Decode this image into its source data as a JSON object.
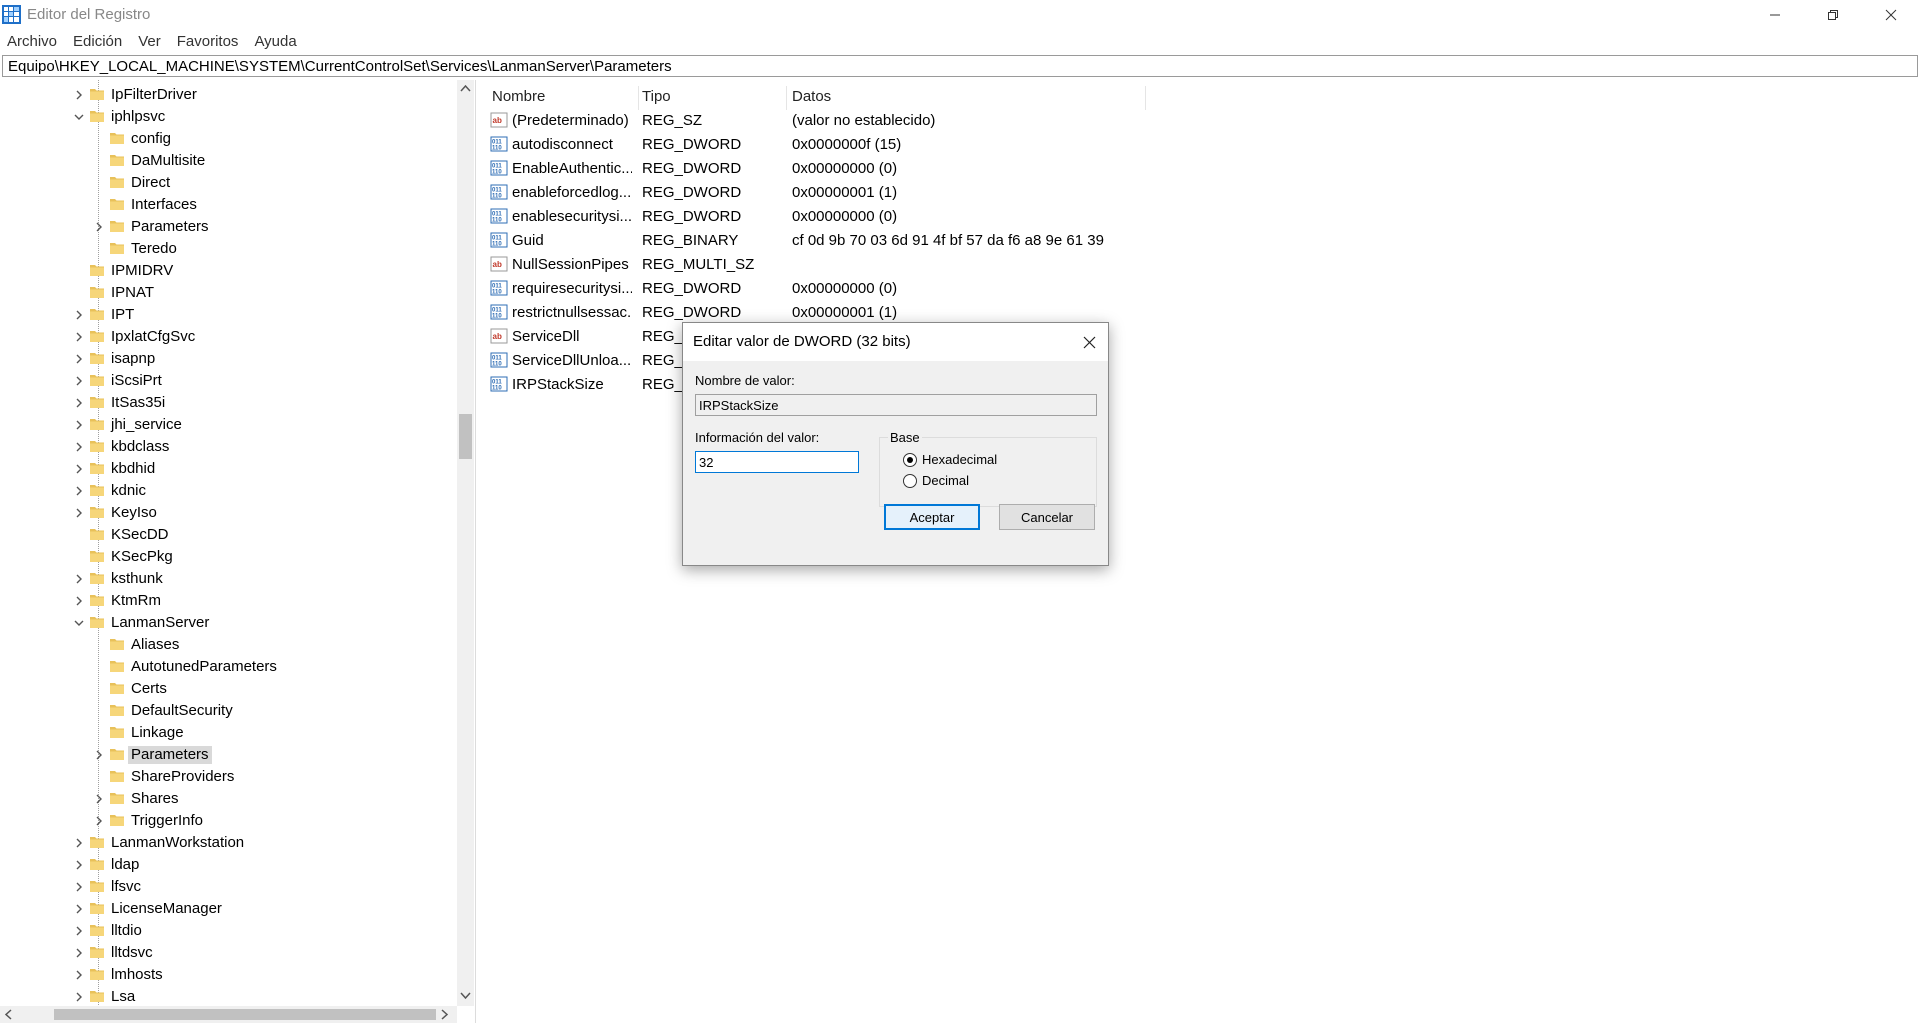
{
  "window": {
    "title": "Editor del Registro"
  },
  "menu": [
    "Archivo",
    "Edición",
    "Ver",
    "Favoritos",
    "Ayuda"
  ],
  "address": "Equipo\\HKEY_LOCAL_MACHINE\\SYSTEM\\CurrentControlSet\\Services\\LanmanServer\\Parameters",
  "tree": [
    {
      "label": "IpFilterDriver",
      "level": 0,
      "expander": "collapsed"
    },
    {
      "label": "iphlpsvc",
      "level": 0,
      "expander": "expanded"
    },
    {
      "label": "config",
      "level": 1,
      "expander": "none"
    },
    {
      "label": "DaMultisite",
      "level": 1,
      "expander": "none"
    },
    {
      "label": "Direct",
      "level": 1,
      "expander": "none"
    },
    {
      "label": "Interfaces",
      "level": 1,
      "expander": "none"
    },
    {
      "label": "Parameters",
      "level": 1,
      "expander": "collapsed"
    },
    {
      "label": "Teredo",
      "level": 1,
      "expander": "none"
    },
    {
      "label": "IPMIDRV",
      "level": 0,
      "expander": "none"
    },
    {
      "label": "IPNAT",
      "level": 0,
      "expander": "none"
    },
    {
      "label": "IPT",
      "level": 0,
      "expander": "collapsed"
    },
    {
      "label": "IpxlatCfgSvc",
      "level": 0,
      "expander": "collapsed"
    },
    {
      "label": "isapnp",
      "level": 0,
      "expander": "collapsed"
    },
    {
      "label": "iScsiPrt",
      "level": 0,
      "expander": "collapsed"
    },
    {
      "label": "ItSas35i",
      "level": 0,
      "expander": "collapsed"
    },
    {
      "label": "jhi_service",
      "level": 0,
      "expander": "collapsed"
    },
    {
      "label": "kbdclass",
      "level": 0,
      "expander": "collapsed"
    },
    {
      "label": "kbdhid",
      "level": 0,
      "expander": "collapsed"
    },
    {
      "label": "kdnic",
      "level": 0,
      "expander": "collapsed"
    },
    {
      "label": "KeyIso",
      "level": 0,
      "expander": "collapsed"
    },
    {
      "label": "KSecDD",
      "level": 0,
      "expander": "none"
    },
    {
      "label": "KSecPkg",
      "level": 0,
      "expander": "none"
    },
    {
      "label": "ksthunk",
      "level": 0,
      "expander": "collapsed"
    },
    {
      "label": "KtmRm",
      "level": 0,
      "expander": "collapsed"
    },
    {
      "label": "LanmanServer",
      "level": 0,
      "expander": "expanded"
    },
    {
      "label": "Aliases",
      "level": 1,
      "expander": "none"
    },
    {
      "label": "AutotunedParameters",
      "level": 1,
      "expander": "none"
    },
    {
      "label": "Certs",
      "level": 1,
      "expander": "none"
    },
    {
      "label": "DefaultSecurity",
      "level": 1,
      "expander": "none"
    },
    {
      "label": "Linkage",
      "level": 1,
      "expander": "none"
    },
    {
      "label": "Parameters",
      "level": 1,
      "expander": "collapsed",
      "selected": true
    },
    {
      "label": "ShareProviders",
      "level": 1,
      "expander": "none"
    },
    {
      "label": "Shares",
      "level": 1,
      "expander": "collapsed"
    },
    {
      "label": "TriggerInfo",
      "level": 1,
      "expander": "collapsed"
    },
    {
      "label": "LanmanWorkstation",
      "level": 0,
      "expander": "collapsed"
    },
    {
      "label": "ldap",
      "level": 0,
      "expander": "collapsed"
    },
    {
      "label": "lfsvc",
      "level": 0,
      "expander": "collapsed"
    },
    {
      "label": "LicenseManager",
      "level": 0,
      "expander": "collapsed"
    },
    {
      "label": "lltdio",
      "level": 0,
      "expander": "collapsed"
    },
    {
      "label": "lltdsvc",
      "level": 0,
      "expander": "collapsed"
    },
    {
      "label": "lmhosts",
      "level": 0,
      "expander": "collapsed"
    },
    {
      "label": "Lsa",
      "level": 0,
      "expander": "collapsed"
    }
  ],
  "columns": {
    "name": "Nombre",
    "type": "Tipo",
    "data": "Datos"
  },
  "values": [
    {
      "icon": "string-value-icon",
      "name": "(Predeterminado)",
      "type": "REG_SZ",
      "data": "(valor no establecido)"
    },
    {
      "icon": "binary-value-icon",
      "name": "autodisconnect",
      "type": "REG_DWORD",
      "data": "0x0000000f (15)"
    },
    {
      "icon": "binary-value-icon",
      "name": "EnableAuthentic...",
      "type": "REG_DWORD",
      "data": "0x00000000 (0)"
    },
    {
      "icon": "binary-value-icon",
      "name": "enableforcedlog...",
      "type": "REG_DWORD",
      "data": "0x00000001 (1)"
    },
    {
      "icon": "binary-value-icon",
      "name": "enablesecuritysi...",
      "type": "REG_DWORD",
      "data": "0x00000000 (0)"
    },
    {
      "icon": "binary-value-icon",
      "name": "Guid",
      "type": "REG_BINARY",
      "data": "cf 0d 9b 70 03 6d 91 4f bf 57 da f6 a8 9e 61 39"
    },
    {
      "icon": "string-value-icon",
      "name": "NullSessionPipes",
      "type": "REG_MULTI_SZ",
      "data": ""
    },
    {
      "icon": "binary-value-icon",
      "name": "requiresecuritysi...",
      "type": "REG_DWORD",
      "data": "0x00000000 (0)"
    },
    {
      "icon": "binary-value-icon",
      "name": "restrictnullsessac...",
      "type": "REG_DWORD",
      "data": "0x00000001 (1)"
    },
    {
      "icon": "string-value-icon",
      "name": "ServiceDll",
      "type": "REG_E",
      "data": ""
    },
    {
      "icon": "binary-value-icon",
      "name": "ServiceDllUnloa...",
      "type": "REG_D",
      "data": ""
    },
    {
      "icon": "binary-value-icon",
      "name": "IRPStackSize",
      "type": "REG_D",
      "data": ""
    }
  ],
  "dialog": {
    "title": "Editar valor de DWORD (32 bits)",
    "name_label": "Nombre de valor:",
    "name_value": "IRPStackSize",
    "data_label": "Información del valor:",
    "data_value": "32",
    "base_label": "Base",
    "hex_label": "Hexadecimal",
    "dec_label": "Decimal",
    "selected_base": "Hexadecimal",
    "ok_label": "Aceptar",
    "cancel_label": "Cancelar",
    "accent_color": "#0078d7"
  }
}
